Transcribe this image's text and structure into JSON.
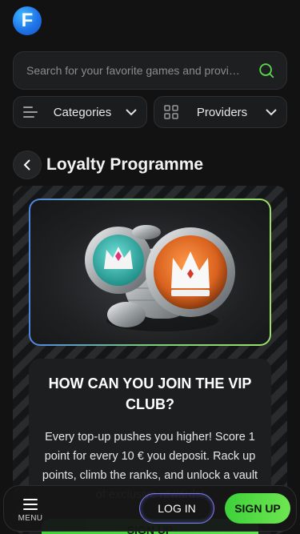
{
  "header": {
    "logo_letter": "F"
  },
  "search": {
    "placeholder": "Search for your favorite games and provi…"
  },
  "filters": {
    "categories_label": "Categories",
    "providers_label": "Providers"
  },
  "page": {
    "title": "Loyalty Programme"
  },
  "promo": {
    "heading": "HOW CAN YOU JOIN THE VIP CLUB?",
    "body": "Every top-up pushes you higher! Score 1 point for every 10 € you deposit. Rack up points, climb the ranks, and unlock a vault of exclusive rewards!",
    "cta_label": "SIGN UP"
  },
  "bottom_nav": {
    "menu_label": "MENU",
    "login_label": "LOG IN",
    "signup_label": "SIGN UP"
  },
  "colors": {
    "accent_green": "#4fd640",
    "accent_blue": "#1f74e8",
    "login_border": "#7f7ff0"
  }
}
